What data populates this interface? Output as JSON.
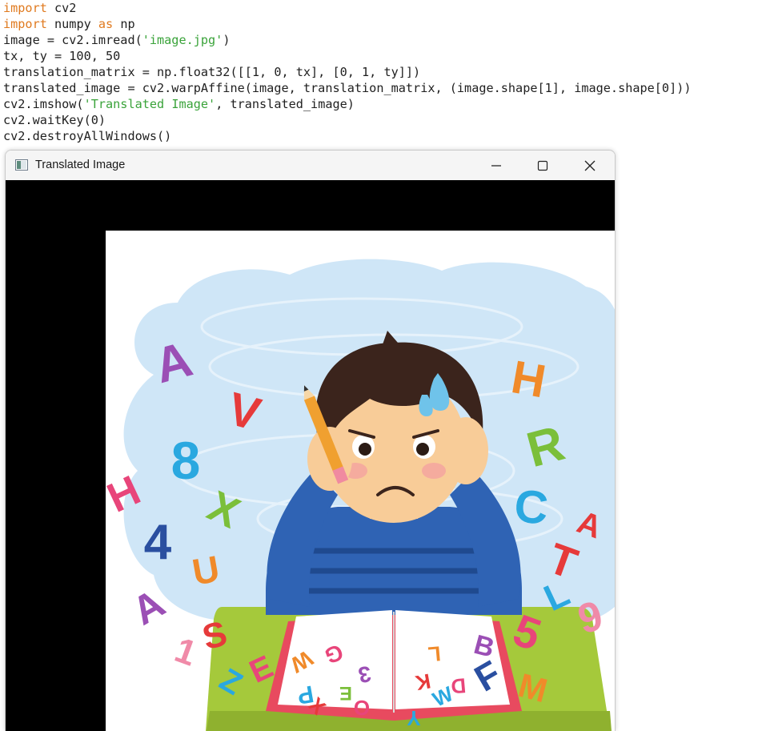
{
  "code": {
    "lines": [
      [
        {
          "t": "import",
          "c": "kw"
        },
        {
          "t": " cv2"
        }
      ],
      [
        {
          "t": "import",
          "c": "kw"
        },
        {
          "t": " numpy "
        },
        {
          "t": "as",
          "c": "kw"
        },
        {
          "t": " np"
        }
      ],
      [
        {
          "t": "image = cv2.imread("
        },
        {
          "t": "'image.jpg'",
          "c": "str"
        },
        {
          "t": ")"
        }
      ],
      [
        {
          "t": "tx, ty = 100, 50"
        }
      ],
      [
        {
          "t": "translation_matrix = np.float32([[1, 0, tx], [0, 1, ty]])"
        }
      ],
      [
        {
          "t": "translated_image = cv2.warpAffine(image, translation_matrix, (image.shape[1], image.shape[0]))"
        }
      ],
      [
        {
          "t": "cv2.imshow("
        },
        {
          "t": "'Translated Image'",
          "c": "str"
        },
        {
          "t": ", translated_image)"
        }
      ],
      [
        {
          "t": "cv2.waitKey(0)"
        }
      ],
      [
        {
          "t": "cv2.destroyAllWindows()"
        }
      ]
    ]
  },
  "window": {
    "title": "Translated Image",
    "controls": {
      "minimize": "minimize-icon",
      "maximize": "maximize-icon",
      "close": "close-icon"
    }
  },
  "picture": {
    "letters": [
      {
        "t": "A",
        "c": "#9b4fb5"
      },
      {
        "t": "V",
        "c": "#e63a3a"
      },
      {
        "t": "8",
        "c": "#2aa8e0"
      },
      {
        "t": "H",
        "c": "#e8457a"
      },
      {
        "t": "X",
        "c": "#7bbf3a"
      },
      {
        "t": "4",
        "c": "#2a4fa0"
      },
      {
        "t": "U",
        "c": "#f08a2a"
      },
      {
        "t": "A",
        "c": "#9b4fb5"
      },
      {
        "t": "S",
        "c": "#e63a3a"
      },
      {
        "t": "1",
        "c": "#f08aa8"
      },
      {
        "t": "Z",
        "c": "#2aa8e0"
      },
      {
        "t": "E",
        "c": "#e8457a"
      },
      {
        "t": "H",
        "c": "#f08a2a"
      },
      {
        "t": "R",
        "c": "#7bbf3a"
      },
      {
        "t": "C",
        "c": "#2aa8e0"
      },
      {
        "t": "T",
        "c": "#e63a3a"
      },
      {
        "t": "L",
        "c": "#2aa8e0"
      },
      {
        "t": "5",
        "c": "#e8457a"
      },
      {
        "t": "F",
        "c": "#2a4fa0"
      },
      {
        "t": "M",
        "c": "#f08a2a"
      },
      {
        "t": "9",
        "c": "#f08aa8"
      },
      {
        "t": "W",
        "c": "#f08a2a"
      },
      {
        "t": "G",
        "c": "#e8457a"
      },
      {
        "t": "P",
        "c": "#2aa8e0"
      },
      {
        "t": "E",
        "c": "#7bbf3a"
      },
      {
        "t": "3",
        "c": "#9b4fb5"
      },
      {
        "t": "X",
        "c": "#e63a3a"
      },
      {
        "t": "O",
        "c": "#e8457a"
      },
      {
        "t": "L",
        "c": "#f08a2a"
      },
      {
        "t": "K",
        "c": "#e63a3a"
      },
      {
        "t": "B",
        "c": "#9b4fb5"
      },
      {
        "t": "D",
        "c": "#e8457a"
      },
      {
        "t": "W",
        "c": "#2aa8e0"
      },
      {
        "t": "Y",
        "c": "#2aa8e0"
      },
      {
        "t": "A",
        "c": "#e63a3a"
      }
    ]
  }
}
